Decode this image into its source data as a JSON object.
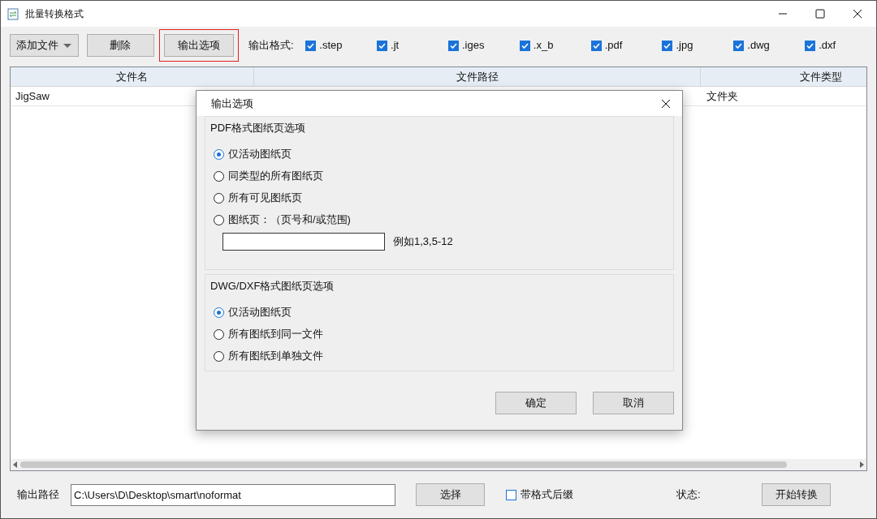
{
  "window": {
    "title": "批量转换格式"
  },
  "toolbar": {
    "add_button": "添加文件",
    "delete_button": "删除",
    "options_button": {
      "label": "输出选项",
      "highlighted": true
    },
    "format_label": "输出格式:",
    "formats": [
      {
        "label": ".step",
        "checked": true
      },
      {
        "label": ".jt",
        "checked": true
      },
      {
        "label": ".iges",
        "checked": true
      },
      {
        "label": ".x_b",
        "checked": true
      },
      {
        "label": ".pdf",
        "checked": true
      },
      {
        "label": ".jpg",
        "checked": true
      },
      {
        "label": ".dwg",
        "checked": true
      },
      {
        "label": ".dxf",
        "checked": true
      }
    ]
  },
  "table": {
    "columns": [
      "文件名",
      "文件路径",
      "文件类型"
    ],
    "rows": [
      {
        "name": "JigSaw",
        "type": "文件夹"
      }
    ]
  },
  "bottom": {
    "path_label": "输出路径",
    "path_value": "C:\\Users\\D\\Desktop\\smart\\noformat",
    "choose_button": "选择",
    "suffix_checkbox": {
      "label": "带格式后缀",
      "checked": false
    },
    "status_label": "状态:",
    "start_button": "开始转换"
  },
  "dialog": {
    "title": "输出选项",
    "groups": [
      {
        "title": "PDF格式图纸页选项",
        "options": [
          {
            "label": "仅活动图纸页",
            "selected": true
          },
          {
            "label": "同类型的所有图纸页",
            "selected": false
          },
          {
            "label": "所有可见图纸页",
            "selected": false
          },
          {
            "label": "图纸页：（页号和/或范围)",
            "selected": false
          }
        ],
        "range_hint": "例如1,3,5-12"
      },
      {
        "title": "DWG/DXF格式图纸页选项",
        "options": [
          {
            "label": "仅活动图纸页",
            "selected": true
          },
          {
            "label": "所有图纸到同一文件",
            "selected": false
          },
          {
            "label": "所有图纸到单独文件",
            "selected": false
          }
        ]
      }
    ],
    "ok_button": "确定",
    "cancel_button": "取消"
  }
}
